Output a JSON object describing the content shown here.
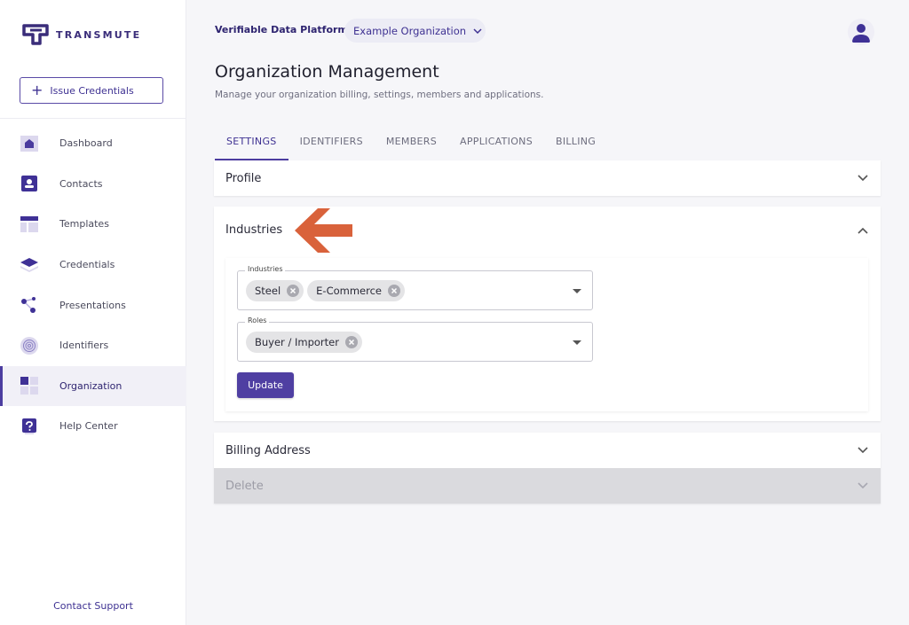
{
  "sidebar": {
    "logo_text": "TRANSMUTE",
    "issue_button": "Issue Credentials",
    "items": [
      {
        "label": "Dashboard",
        "icon": "home-icon"
      },
      {
        "label": "Contacts",
        "icon": "contact-card-icon"
      },
      {
        "label": "Templates",
        "icon": "template-icon"
      },
      {
        "label": "Credentials",
        "icon": "credentials-layers-icon"
      },
      {
        "label": "Presentations",
        "icon": "presentations-network-icon"
      },
      {
        "label": "Identifiers",
        "icon": "fingerprint-icon"
      },
      {
        "label": "Organization",
        "icon": "organization-grid-icon",
        "active": true
      },
      {
        "label": "Help Center",
        "icon": "help-icon"
      }
    ],
    "contact_support": "Contact Support"
  },
  "header": {
    "platform": "Verifiable Data Platform",
    "org_select": "Example Organization",
    "avatar_icon": "user-avatar-icon"
  },
  "page": {
    "title": "Organization Management",
    "subtitle": "Manage your organization billing, settings, members and applications."
  },
  "tabs": [
    "SETTINGS",
    "IDENTIFIERS",
    "MEMBERS",
    "APPLICATIONS",
    "BILLING"
  ],
  "active_tab": "SETTINGS",
  "panels": {
    "profile": "Profile",
    "industries": "Industries",
    "billing_address": "Billing Address",
    "delete": "Delete"
  },
  "industries_form": {
    "industries_label": "Industries",
    "industries_values": [
      "Steel",
      "E-Commerce"
    ],
    "roles_label": "Roles",
    "roles_values": [
      "Buyer / Importer"
    ],
    "update_button": "Update"
  },
  "colors": {
    "accent": "#4f3fa2",
    "arrow": "#d9623b",
    "background": "#f6f6f9"
  }
}
